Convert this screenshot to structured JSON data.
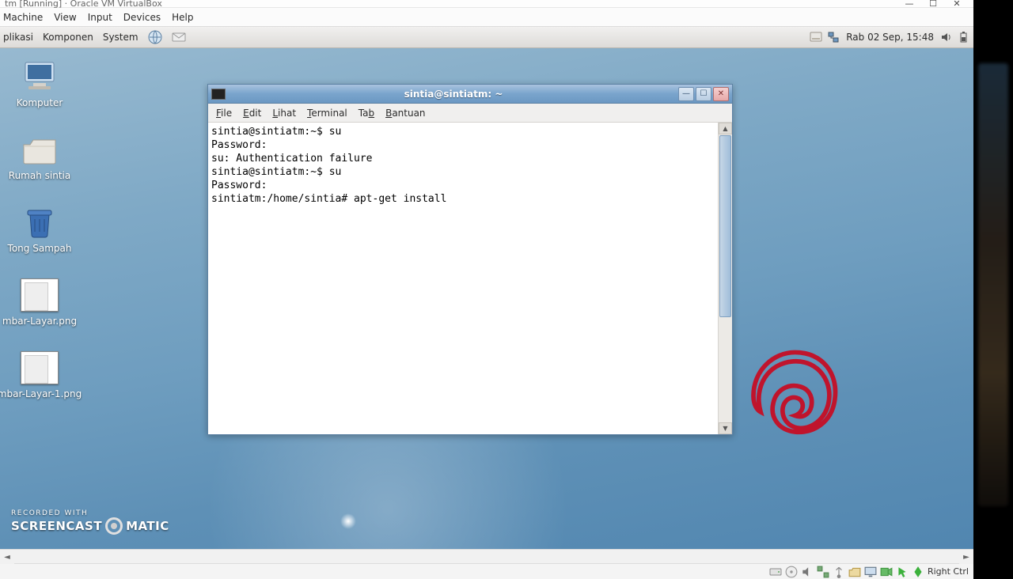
{
  "host": {
    "title_fragment": "tm [Running] · Oracle VM VirtualBox",
    "menu": [
      "Machine",
      "View",
      "Input",
      "Devices",
      "Help"
    ],
    "buttons": {
      "min": "—",
      "max": "☐",
      "close": "✕"
    }
  },
  "panel": {
    "menu": [
      "plikasi",
      "Komponen",
      "System"
    ],
    "clock": "Rab 02 Sep, 15:48"
  },
  "desktop_icons": [
    {
      "name": "komputer",
      "label": "Komputer",
      "kind": "computer"
    },
    {
      "name": "rumah",
      "label": "Rumah sintia",
      "kind": "folder"
    },
    {
      "name": "trash",
      "label": "Tong Sampah",
      "kind": "trash"
    },
    {
      "name": "shot1",
      "label": "mbar-Layar.png",
      "kind": "thumb"
    },
    {
      "name": "shot2",
      "label": "mbar-Layar-1.png",
      "kind": "thumb"
    }
  ],
  "terminal": {
    "title": "sintia@sintiatm: ~",
    "menu": [
      {
        "html": "File",
        "u": 0
      },
      {
        "html": "Edit",
        "u": 0
      },
      {
        "html": "Lihat",
        "u": 0
      },
      {
        "html": "Terminal",
        "u": 0
      },
      {
        "html": "Tab",
        "u": 2
      },
      {
        "html": "Bantuan",
        "u": 0
      }
    ],
    "lines": [
      "sintia@sintiatm:~$ su",
      "Password:",
      "su: Authentication failure",
      "sintia@sintiatm:~$ su",
      "Password:",
      "sintiatm:/home/sintia# apt-get install"
    ]
  },
  "watermark": {
    "small": "RECORDED WITH",
    "brand_a": "SCREENCAST",
    "brand_b": "MATIC"
  },
  "statusbar": {
    "hostkey": "Right Ctrl"
  }
}
